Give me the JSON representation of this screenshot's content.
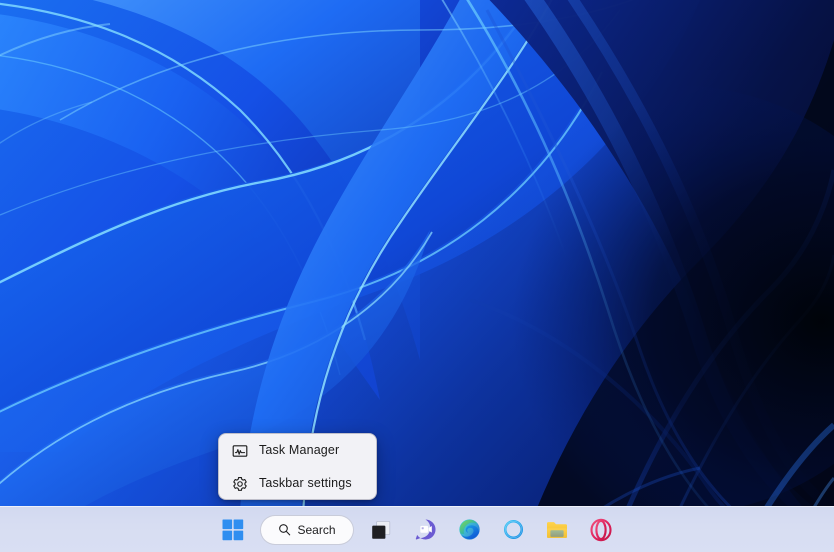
{
  "desktop": {
    "wallpaper_name": "windows-11-bloom-wallpaper",
    "colors": {
      "deep_navy": "#050b33",
      "near_black": "#02030f",
      "mid_blue": "#1757e8",
      "bright_blue": "#1f7cf5",
      "cyan_highlight": "#6fd0ff",
      "royal_blue": "#0f3fd8"
    }
  },
  "context_menu": {
    "name": "taskbar-context-menu",
    "background": "#f2f2f6",
    "items": [
      {
        "label": "Task Manager",
        "icon": "task-manager-icon"
      },
      {
        "label": "Taskbar settings",
        "icon": "gear-icon"
      }
    ]
  },
  "taskbar": {
    "background": "#d7ddf2",
    "search": {
      "label": "Search",
      "placeholder": "Search",
      "icon": "search-icon"
    },
    "buttons": [
      {
        "name": "start-button",
        "label": "Start",
        "icon": "windows-logo-icon"
      },
      {
        "name": "task-view-button",
        "label": "Task view",
        "icon": "task-view-icon"
      },
      {
        "name": "chat-button",
        "label": "Chat",
        "icon": "chat-icon"
      },
      {
        "name": "edge-button",
        "label": "Microsoft Edge",
        "icon": "edge-icon"
      },
      {
        "name": "cortana-button",
        "label": "Cortana",
        "icon": "ring-icon"
      },
      {
        "name": "file-explorer-button",
        "label": "File Explorer",
        "icon": "folder-icon"
      },
      {
        "name": "opera-button",
        "label": "Opera",
        "icon": "opera-icon"
      }
    ]
  }
}
